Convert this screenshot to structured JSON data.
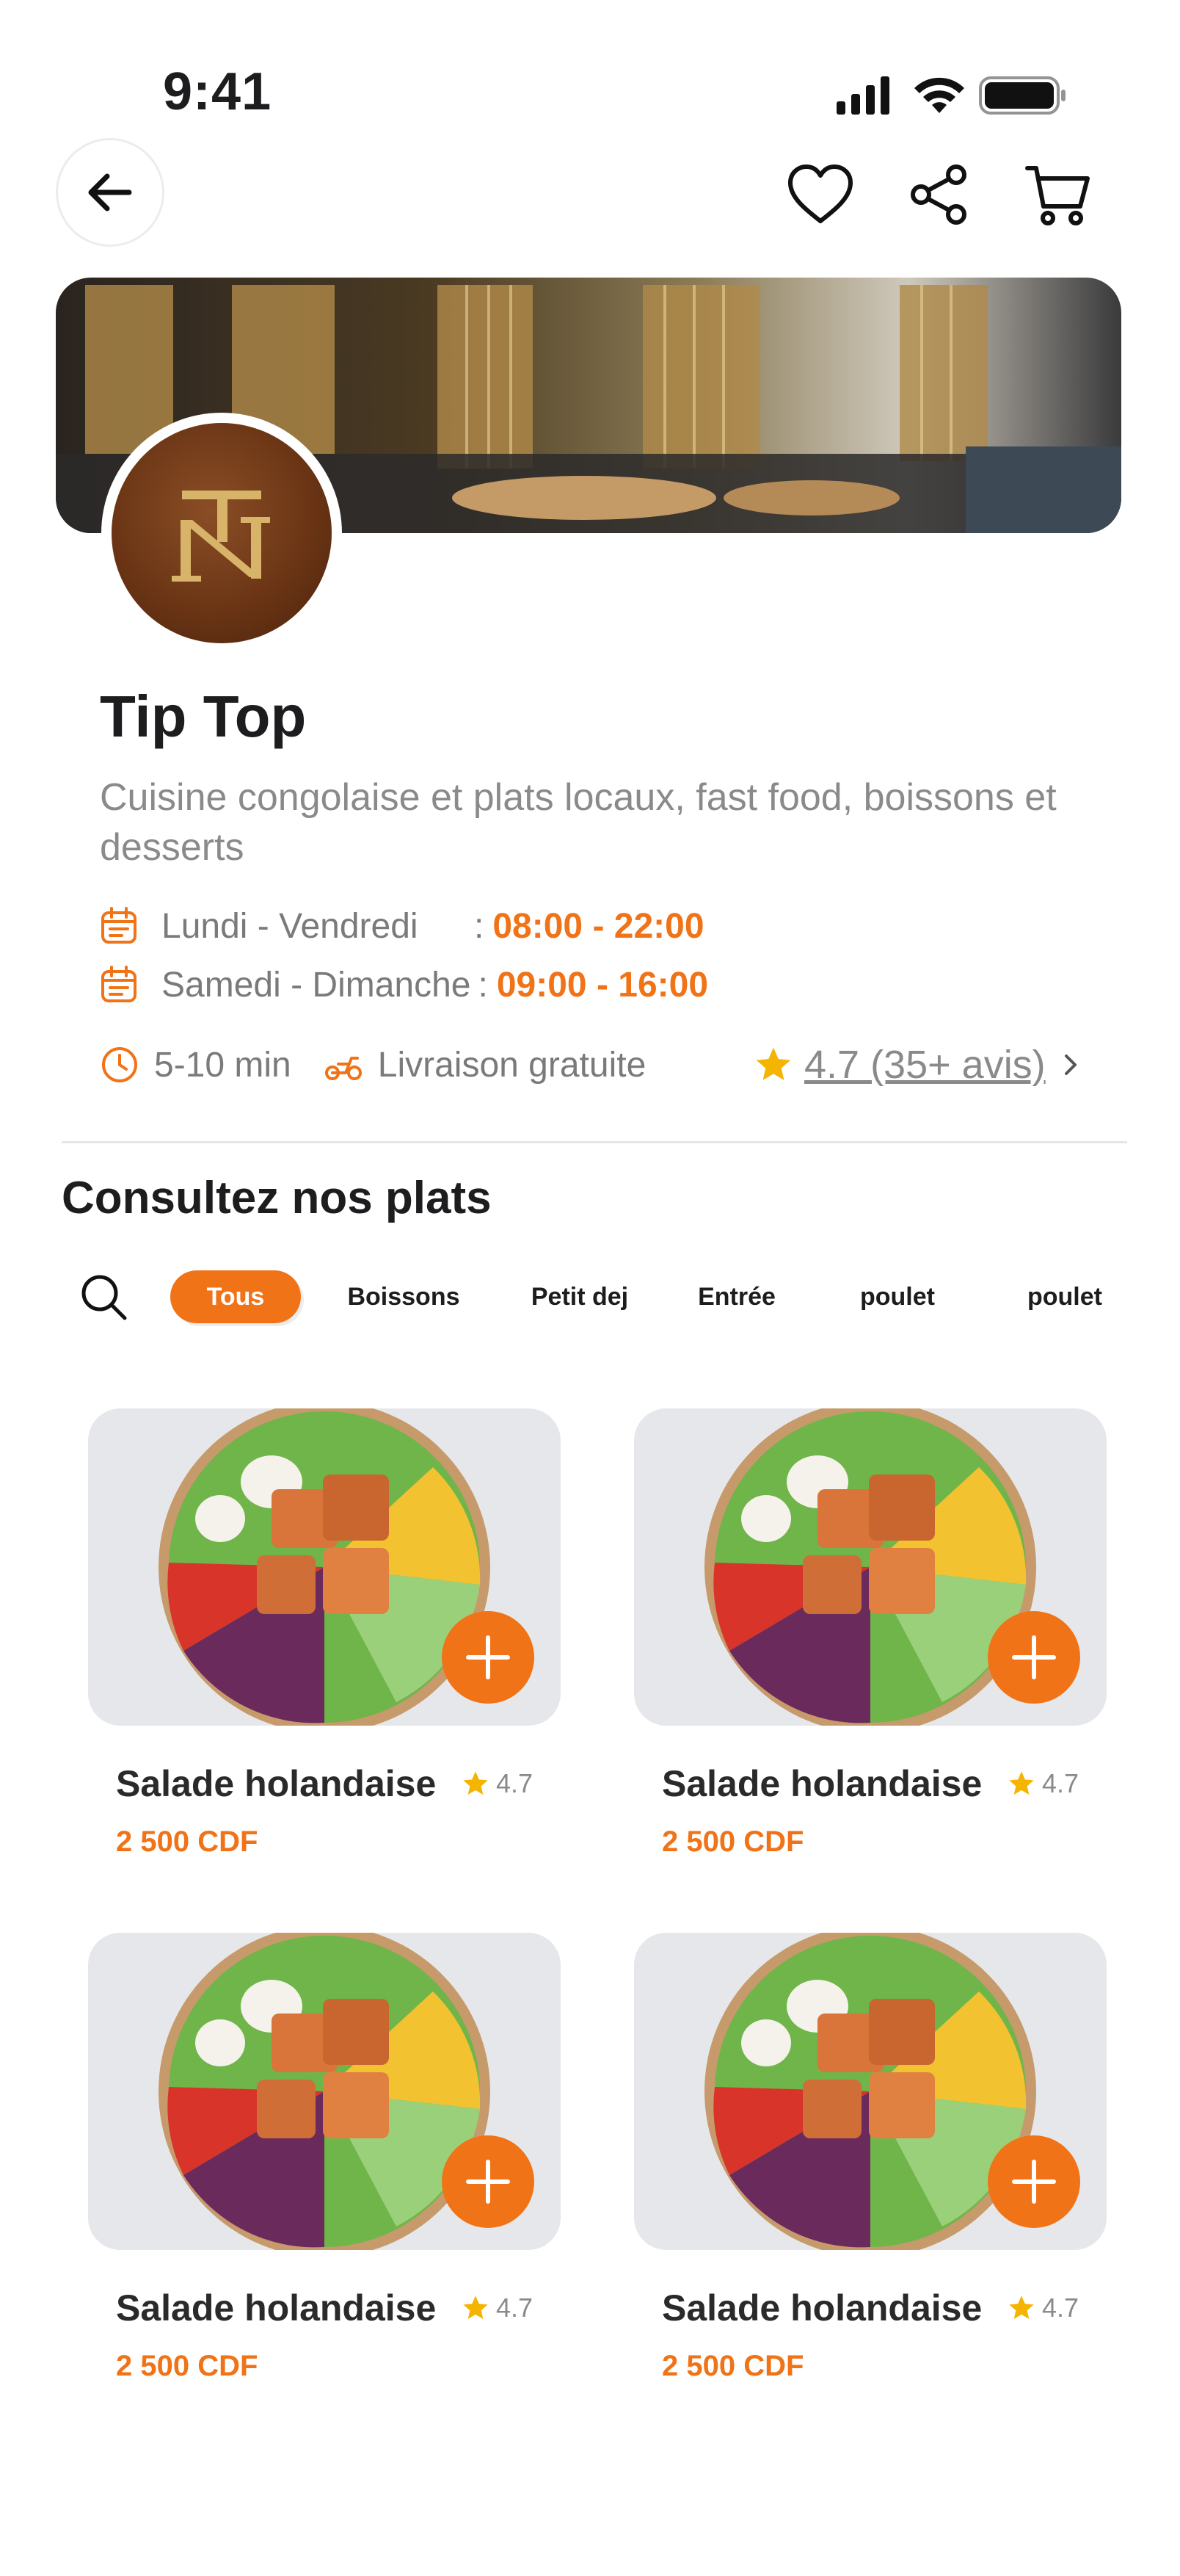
{
  "status_bar": {
    "time": "9:41"
  },
  "restaurant": {
    "name": "Tip Top",
    "description": "Cuisine congolaise et plats locaux, fast food, boissons et desserts",
    "hours": [
      {
        "days": "Lundi - Vendredi",
        "sep": ":",
        "time": "08:00 - 22:00"
      },
      {
        "days": "Samedi - Dimanche",
        "sep": ":",
        "time": "09:00 - 16:00"
      }
    ],
    "delivery_time": "5-10 min",
    "delivery_fee": "Livraison gratuite",
    "rating": "4.7 (35+ avis)"
  },
  "menu": {
    "section_title": "Consultez nos plats",
    "filters": [
      "Tous",
      "Boissons",
      "Petit dej",
      "Entrée",
      "poulet",
      "poulet"
    ],
    "active_filter": "Tous",
    "items": [
      {
        "name": "Salade holandaise",
        "rating": "4.7",
        "price": "2 500 CDF"
      },
      {
        "name": "Salade holandaise",
        "rating": "4.7",
        "price": "2 500 CDF"
      },
      {
        "name": "Salade holandaise",
        "rating": "4.7",
        "price": "2 500 CDF"
      },
      {
        "name": "Salade holandaise",
        "rating": "4.7",
        "price": "2 500 CDF"
      }
    ]
  },
  "icons": {
    "back": "arrow-left-icon",
    "favorite": "heart-icon",
    "share": "share-icon",
    "cart": "cart-icon",
    "calendar": "calendar-icon",
    "clock": "clock-icon",
    "delivery": "scooter-icon",
    "star": "star-icon",
    "chevron": "chevron-right-icon",
    "search": "search-icon",
    "add": "plus-icon"
  },
  "colors": {
    "accent": "#f07318",
    "star": "#f5b400",
    "muted": "#8a8a8a"
  }
}
